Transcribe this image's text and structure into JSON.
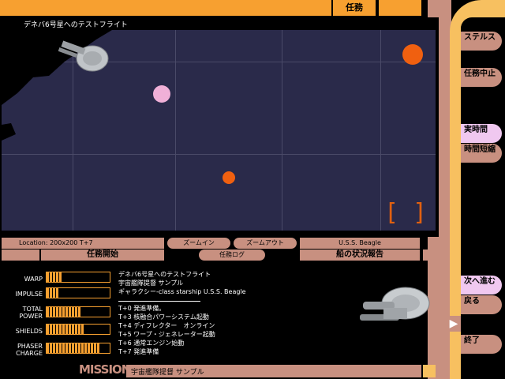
{
  "header": {
    "title": "任務"
  },
  "map": {
    "title": "デネバ6号星へのテストフライト",
    "location": "Location: 200x200 T+7",
    "zoom_in": "ズームイン",
    "zoom_out": "ズームアウト",
    "ship_name": "U.S.S. Beagle",
    "mission_start": "任務開始",
    "mission_log": "任務ログ",
    "ship_status": "船の状況報告"
  },
  "sidebar": {
    "items": [
      {
        "label": "ステルス"
      },
      {
        "label": "任務中止"
      },
      {
        "label": "実時間"
      },
      {
        "label": "時間短縮"
      },
      {
        "label": "次へ進む"
      },
      {
        "label": "戻る"
      },
      {
        "label": "終了"
      }
    ]
  },
  "meters": [
    {
      "label": "WARP",
      "level": 0.25
    },
    {
      "label": "IMPULSE",
      "level": 0.2
    },
    {
      "label": "TOTAL POWER",
      "level": 0.55
    },
    {
      "label": "SHIELDS",
      "level": 0.6
    },
    {
      "label": "PHASER CHARGE",
      "level": 0.85
    }
  ],
  "info": {
    "line1": "デネバ6号星へのテストフライト",
    "line2": "宇宙艦隊提督 サンプル",
    "line3": "ギャラクシー-class starship U.S.S. Beagle"
  },
  "log": [
    "T+0 発進準備。",
    "T+3 核融合パワーシステム起動",
    "T+4 ディフレクター　オンライン",
    "T+5 ワープ・ジェネレーター起動",
    "T+6 通常エンジン始動",
    "T+7 発進準備"
  ],
  "footer": {
    "mission": "MISSION",
    "admiral": "宇宙艦隊提督 サンプル"
  },
  "colors": {
    "accent": "#f7a030",
    "frame": "#c89080",
    "gold": "#f7c060",
    "space": "#2a2a4a"
  }
}
